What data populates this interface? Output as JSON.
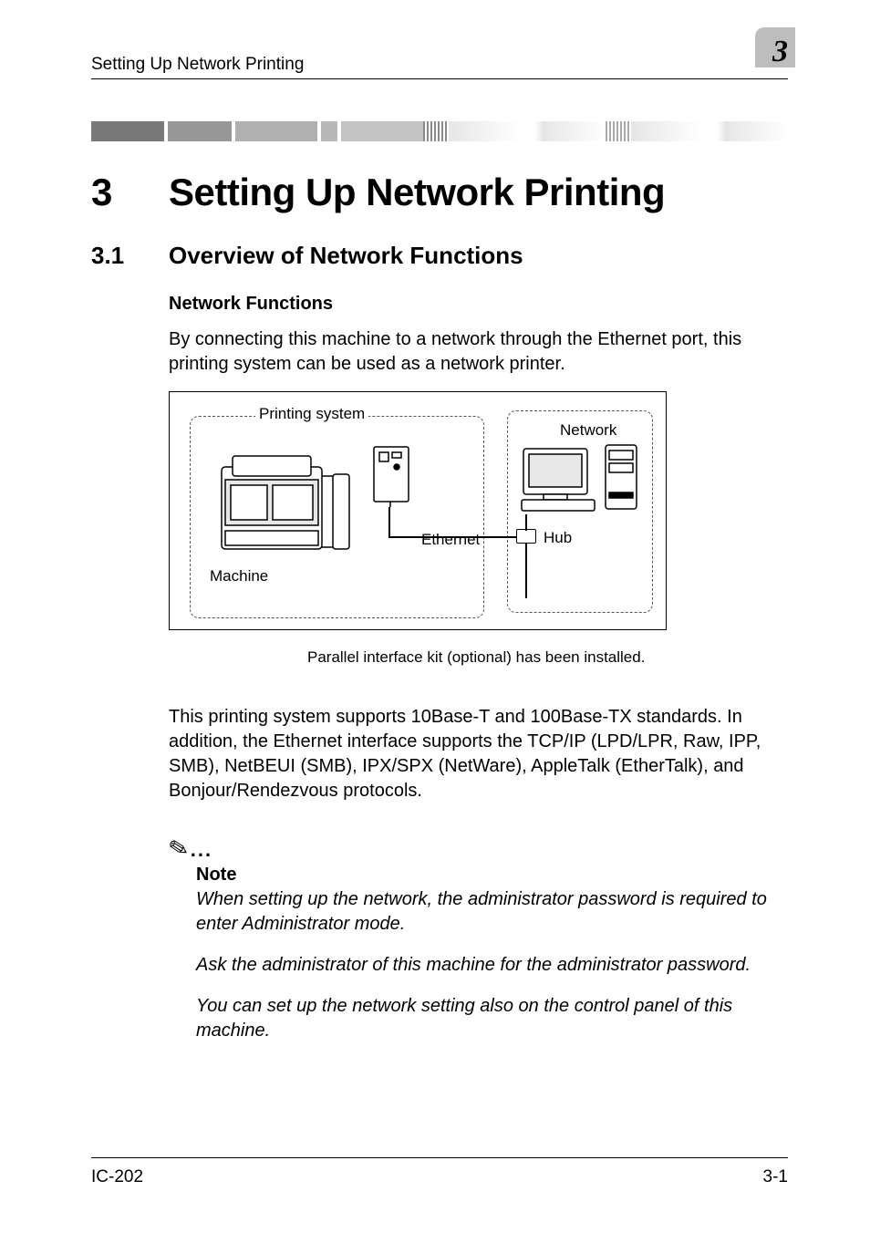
{
  "header": {
    "running_title": "Setting Up Network Printing",
    "chapter_num_corner": "3"
  },
  "chapter": {
    "number": "3",
    "title": "Setting Up Network Printing"
  },
  "section": {
    "number": "3.1",
    "title": "Overview of Network Functions"
  },
  "subsection_heading": "Network Functions",
  "intro_paragraph": "By connecting this machine to a network through the Ethernet port, this printing system can be used as a network printer.",
  "diagram": {
    "label_printing_system": "Printing system",
    "label_network": "Network",
    "label_ethernet": "Ethernet",
    "label_hub": "Hub",
    "label_machine": "Machine"
  },
  "diagram_caption": "Parallel interface kit (optional) has been installed.",
  "protocols_paragraph": "This printing system supports 10Base-T and 100Base-TX standards. In addition, the Ethernet interface supports the TCP/IP (LPD/LPR, Raw, IPP, SMB), NetBEUI (SMB), IPX/SPX (NetWare), AppleTalk (EtherTalk), and Bonjour/Rendezvous protocols.",
  "note": {
    "heading": "Note",
    "line1": "When setting up the network, the administrator password is required to enter Administrator mode.",
    "line2": "Ask the administrator of this machine for the administrator password.",
    "line3": "You can set up the network setting also on the control panel of this machine."
  },
  "footer": {
    "model": "IC-202",
    "page": "3-1"
  }
}
